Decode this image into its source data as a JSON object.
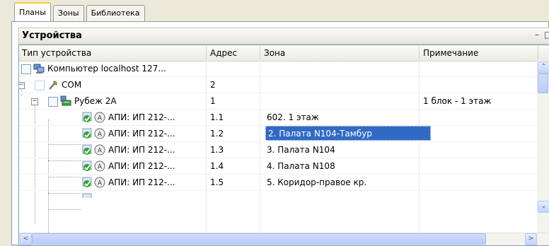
{
  "tabs": [
    {
      "label": "Планы",
      "active": true
    },
    {
      "label": "Зоны",
      "active": false
    },
    {
      "label": "Библиотека",
      "active": false
    }
  ],
  "panel": {
    "title": "Устройства",
    "minimize_glyph": "–",
    "maximize_glyph": "□"
  },
  "columns": [
    "Тип устройства",
    "Адрес",
    "Зона",
    "Примечание"
  ],
  "rows": [
    {
      "type": "Компьютер localhost 127...",
      "address": "",
      "zone": "",
      "note": "",
      "level": 0,
      "icon": "computer-icon"
    },
    {
      "type": "COM",
      "address": "2",
      "zone": "",
      "note": "",
      "level": 1,
      "icon": "com-port-icon"
    },
    {
      "type": "Рубеж 2А",
      "address": "1",
      "zone": "",
      "note": "1 блок - 1 этаж",
      "level": 2,
      "icon": "device-icon"
    },
    {
      "type": "АПИ: ИП 212-...",
      "address": "1.1",
      "zone": "602. 1 этаж",
      "note": "",
      "level": 3,
      "icon": "detector-icon"
    },
    {
      "type": "АПИ: ИП 212-...",
      "address": "1.2",
      "zone": "2. Палата N104-Тамбур",
      "note": "",
      "level": 3,
      "icon": "detector-icon",
      "selected": true
    },
    {
      "type": "АПИ: ИП 212-...",
      "address": "1.3",
      "zone": "3. Палата N104",
      "note": "",
      "level": 3,
      "icon": "detector-icon"
    },
    {
      "type": "АПИ: ИП 212-...",
      "address": "1.4",
      "zone": "4. Палата N108",
      "note": "",
      "level": 3,
      "icon": "detector-icon"
    },
    {
      "type": "АПИ: ИП 212-...",
      "address": "1.5",
      "zone": "5. Коридор-правое кр.",
      "note": "",
      "level": 3,
      "icon": "detector-icon"
    }
  ],
  "colors": {
    "selection": "#316ac5",
    "check_green": "#2ea22e",
    "tab_accent": "#ffc83c"
  },
  "scrollbars": {
    "up_glyph": "⌃",
    "down_glyph": "⌄",
    "left_glyph": "<",
    "right_glyph": ">"
  }
}
